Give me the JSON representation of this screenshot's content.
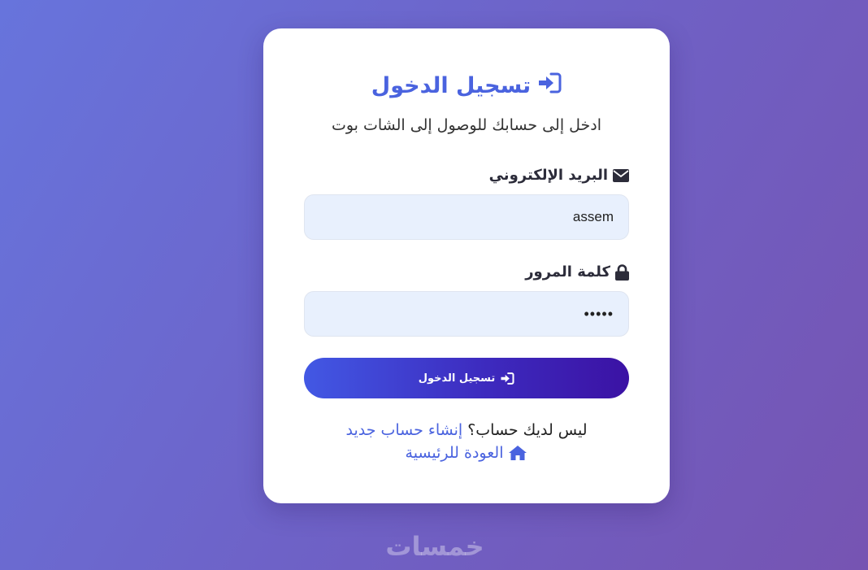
{
  "login": {
    "title": "تسجيل الدخول",
    "subtitle": "ادخل إلى حسابك للوصول إلى الشات بوت",
    "email_label": "البريد الإلكتروني",
    "email_value": "assem",
    "password_label": "كلمة المرور",
    "password_value": "•••••",
    "submit_label": "تسجيل الدخول",
    "no_account_text": "ليس لديك حساب؟",
    "register_link": "إنشاء حساب جديد",
    "home_link": "العودة للرئيسية"
  },
  "watermark": "خمسات",
  "icons": {
    "title": "sign-in-icon",
    "email": "envelope-icon",
    "password": "lock-icon",
    "submit": "sign-in-icon",
    "home": "home-icon"
  },
  "colors": {
    "accent": "#4a63df",
    "button_start": "#4258e4",
    "button_end": "#3b12a4",
    "input_bg": "#e8f0fd"
  }
}
